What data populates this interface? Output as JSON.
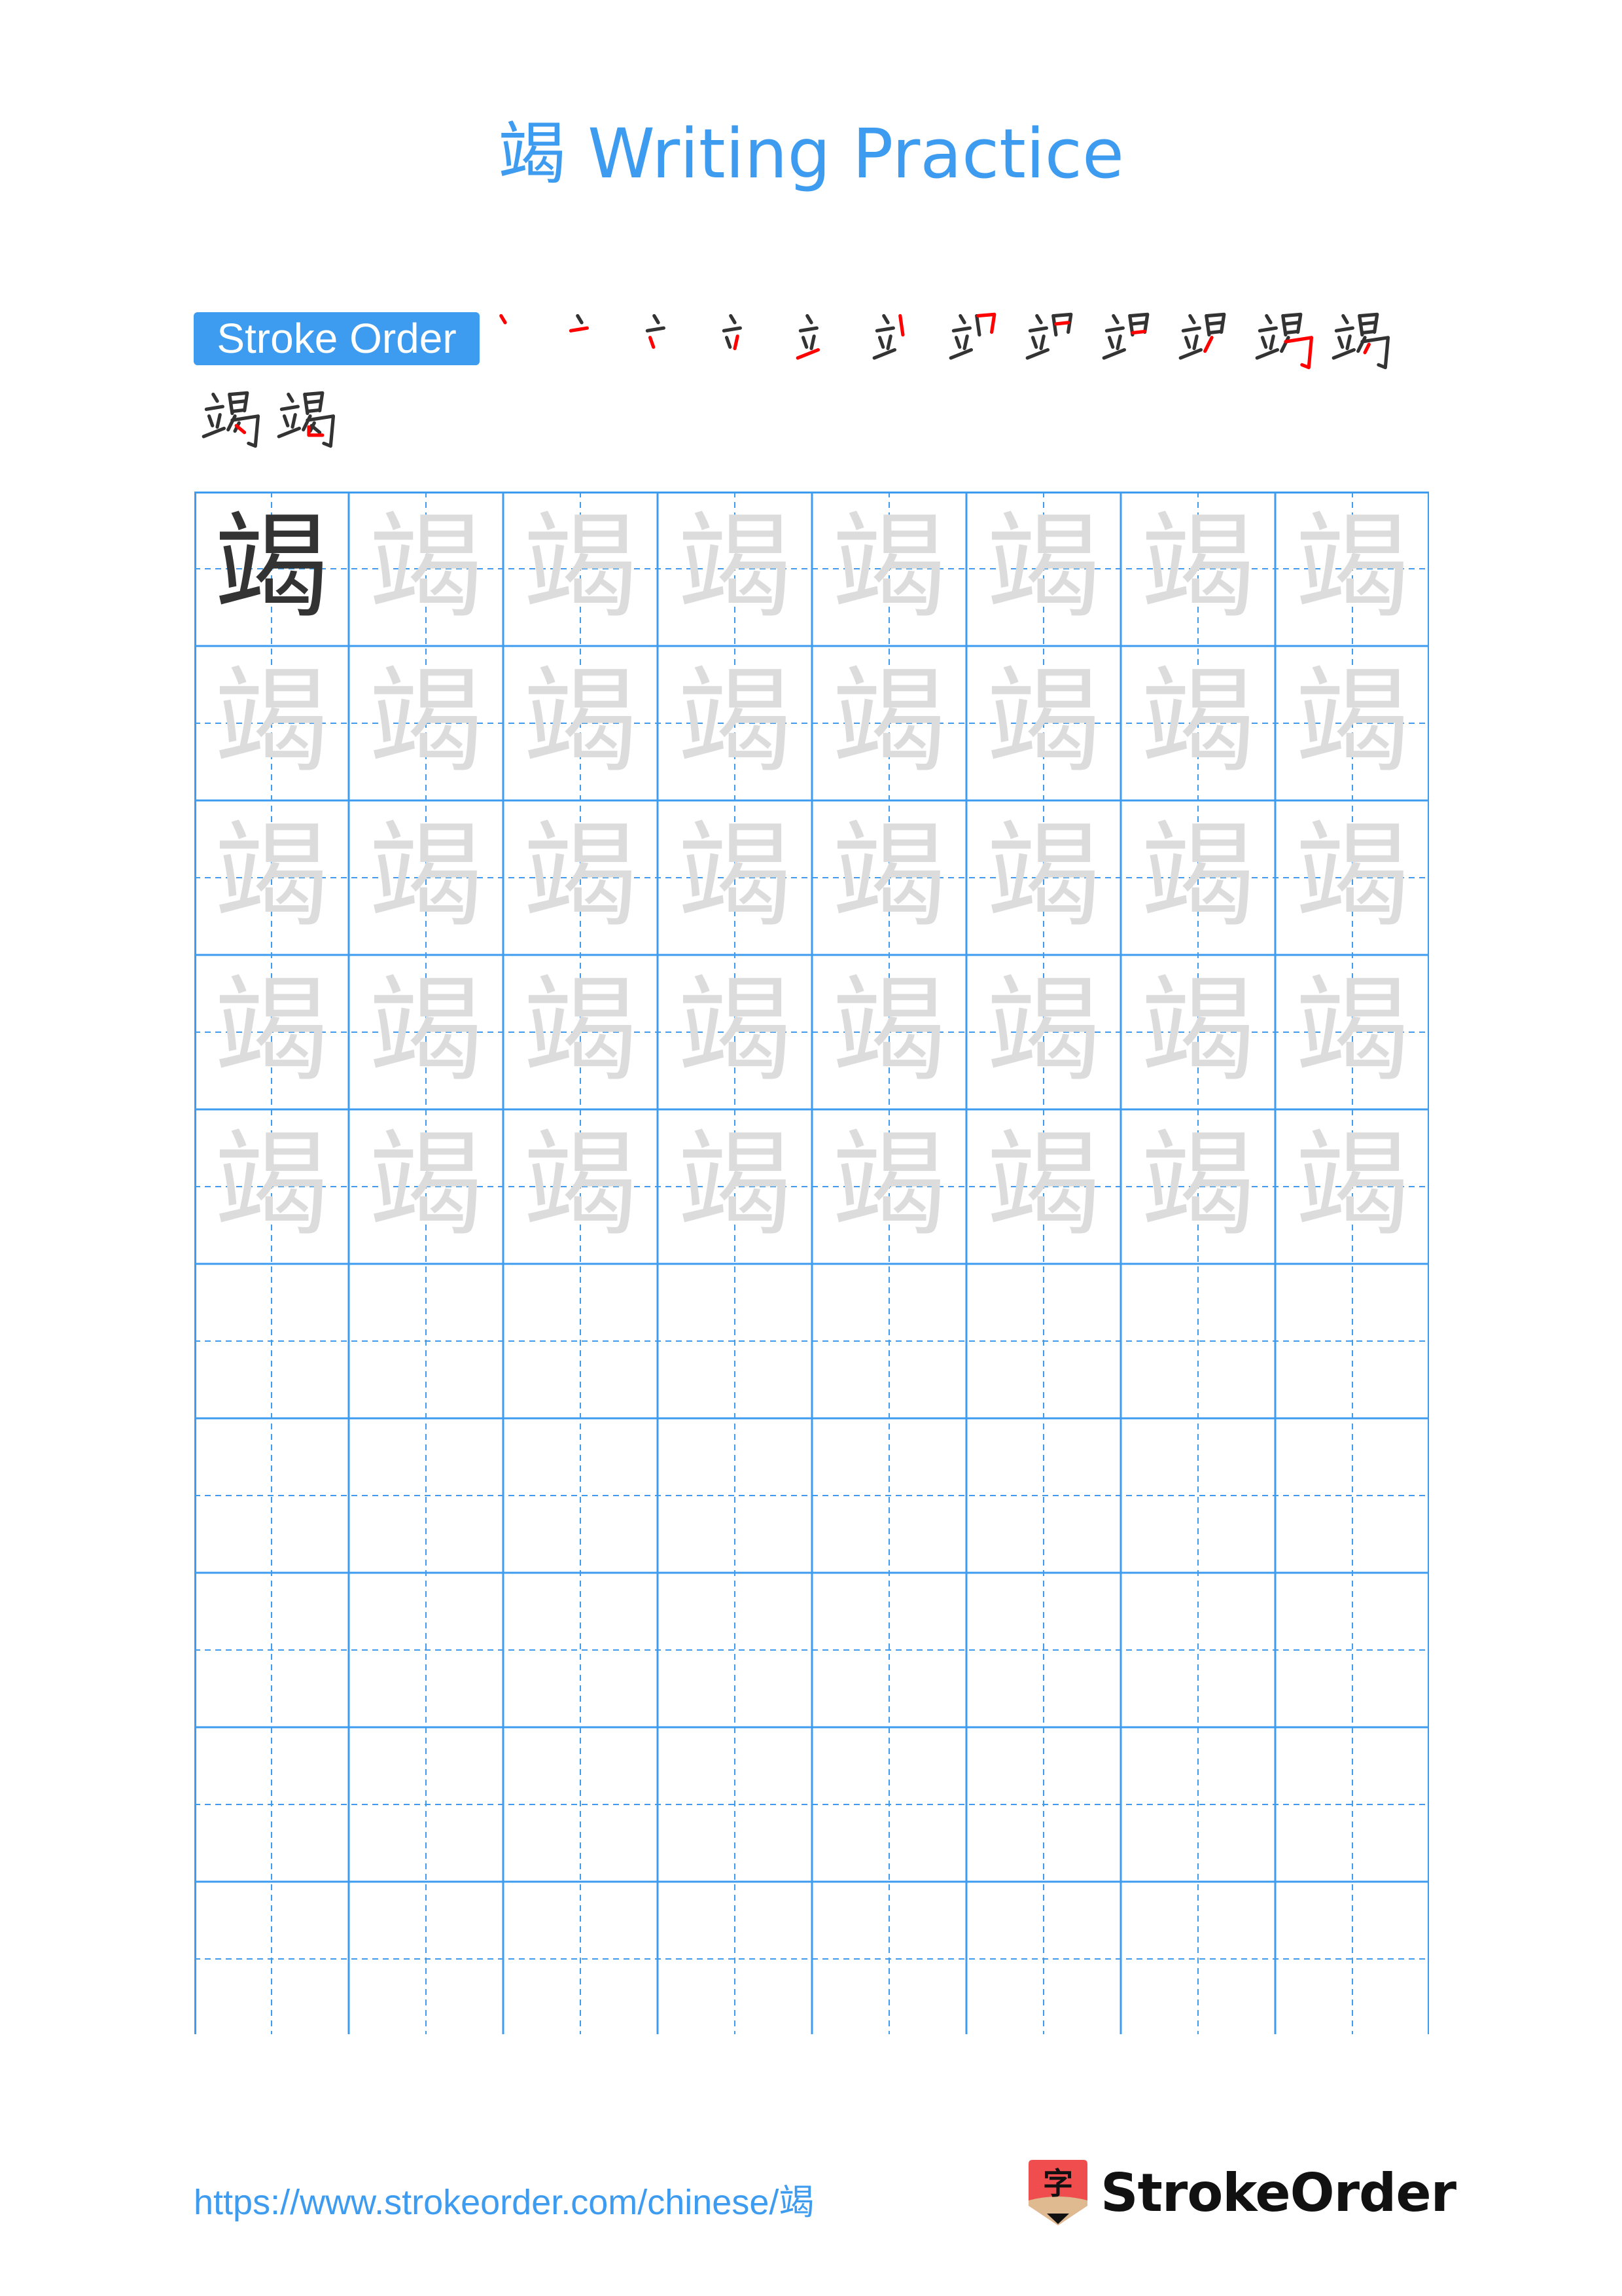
{
  "page": {
    "character": "竭",
    "title": "竭 Writing Practice",
    "colors": {
      "accent": "#3d9bf0",
      "model_glyph": "#333333",
      "trace_glyph": "#dcdcdc",
      "stroke_current": "#ff0000",
      "stroke_done": "#333333",
      "grid_line": "#3d9bf0",
      "logo_red": "#f04e4e",
      "logo_tan": "#dfb98f"
    }
  },
  "stroke_order": {
    "label": "Stroke Order",
    "total_strokes": 14,
    "steps": [
      1,
      2,
      3,
      4,
      5,
      6,
      7,
      8,
      9,
      10,
      11,
      12,
      13,
      14
    ]
  },
  "grid": {
    "columns": 8,
    "rows": 10,
    "model_cells": 1,
    "trace_rows": 5,
    "blank_rows": 5
  },
  "footer": {
    "url": "https://www.strokeorder.com/chinese/竭",
    "brand": "StrokeOrder",
    "logo_glyph": "字"
  }
}
